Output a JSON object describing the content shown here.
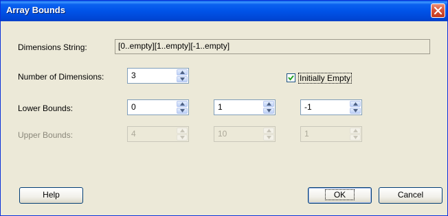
{
  "window": {
    "title": "Array Bounds"
  },
  "dimensions_string": {
    "label": "Dimensions String:",
    "value": "[0..empty][1..empty][-1..empty]"
  },
  "number_of_dimensions": {
    "label": "Number of Dimensions:",
    "value": "3"
  },
  "initially_empty": {
    "label": "Initially Empty",
    "checked": true
  },
  "lower_bounds": {
    "label": "Lower Bounds:",
    "values": [
      "0",
      "1",
      "-1"
    ]
  },
  "upper_bounds": {
    "label": "Upper Bounds:",
    "values": [
      "4",
      "10",
      "1"
    ],
    "enabled": false
  },
  "buttons": {
    "help": "Help",
    "ok": "OK",
    "cancel": "Cancel"
  },
  "icons": {
    "close": "close-icon",
    "spin_up": "arrow-up-icon",
    "spin_down": "arrow-down-icon",
    "check": "checkmark-icon"
  },
  "colors": {
    "titlebar": "#0053e8",
    "window_bg": "#ece9d8",
    "close_button": "#d8553a"
  }
}
